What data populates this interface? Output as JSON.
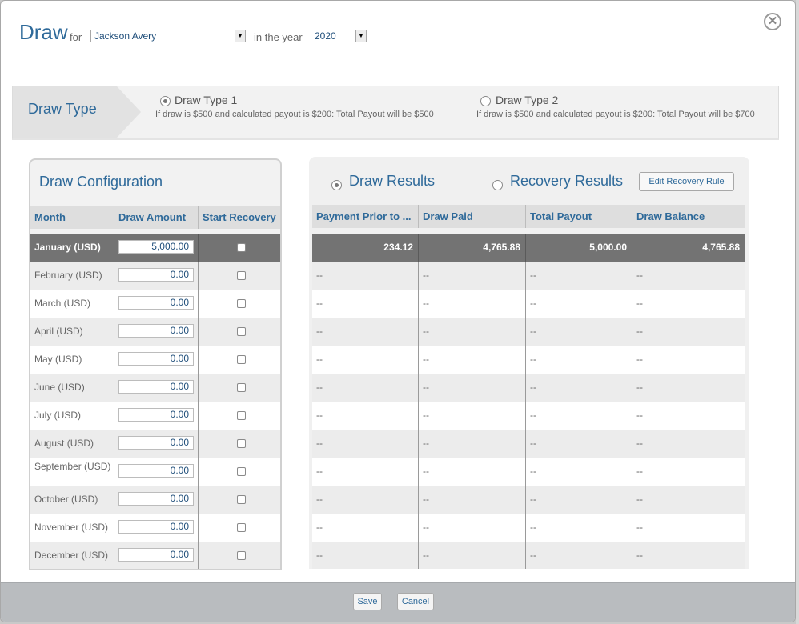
{
  "header": {
    "title": "Draw",
    "for_label": "for",
    "person": "Jackson Avery",
    "year_label": "in the year",
    "year": "2020"
  },
  "draw_type": {
    "label": "Draw Type",
    "options": [
      {
        "title": "Draw Type 1",
        "desc": "If draw is $500 and calculated payout is $200: Total Payout will be $500",
        "checked": true
      },
      {
        "title": "Draw Type 2",
        "desc": "If draw is $500 and calculated payout is $200: Total Payout will be $700",
        "checked": false
      }
    ]
  },
  "config": {
    "title": "Draw Configuration",
    "columns": [
      "Month",
      "Draw Amount",
      "Start Recovery"
    ],
    "rows": [
      {
        "month": "January (USD)",
        "amount": "5,000.00"
      },
      {
        "month": "February (USD)",
        "amount": "0.00"
      },
      {
        "month": "March (USD)",
        "amount": "0.00"
      },
      {
        "month": "April (USD)",
        "amount": "0.00"
      },
      {
        "month": "May (USD)",
        "amount": "0.00"
      },
      {
        "month": "June (USD)",
        "amount": "0.00"
      },
      {
        "month": "July (USD)",
        "amount": "0.00"
      },
      {
        "month": "August (USD)",
        "amount": "0.00"
      },
      {
        "month": "September (USD)",
        "amount": "0.00"
      },
      {
        "month": "October (USD)",
        "amount": "0.00"
      },
      {
        "month": "November (USD)",
        "amount": "0.00"
      },
      {
        "month": "December (USD)",
        "amount": "0.00"
      }
    ]
  },
  "results": {
    "draw_results_label": "Draw Results",
    "recovery_results_label": "Recovery Results",
    "edit_rule_label": "Edit Recovery Rule",
    "columns": [
      "Payment Prior to ...",
      "Draw Paid",
      "Total Payout",
      "Draw Balance"
    ],
    "rows": [
      [
        "234.12",
        "4,765.88",
        "5,000.00",
        "4,765.88"
      ],
      [
        "--",
        "--",
        "--",
        "--"
      ],
      [
        "--",
        "--",
        "--",
        "--"
      ],
      [
        "--",
        "--",
        "--",
        "--"
      ],
      [
        "--",
        "--",
        "--",
        "--"
      ],
      [
        "--",
        "--",
        "--",
        "--"
      ],
      [
        "--",
        "--",
        "--",
        "--"
      ],
      [
        "--",
        "--",
        "--",
        "--"
      ],
      [
        "--",
        "--",
        "--",
        "--"
      ],
      [
        "--",
        "--",
        "--",
        "--"
      ],
      [
        "--",
        "--",
        "--",
        "--"
      ],
      [
        "--",
        "--",
        "--",
        "--"
      ]
    ]
  },
  "footer": {
    "save_label": "Save",
    "cancel_label": "Cancel"
  },
  "icons": {
    "close": "close-icon",
    "dropdown": "chevron-down-icon"
  },
  "colors": {
    "accent": "#2f6a9a",
    "selected_row": "#737373"
  }
}
